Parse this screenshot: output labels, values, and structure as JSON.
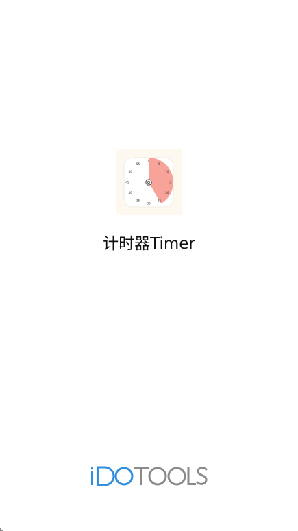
{
  "app": {
    "name": "计时器Timer",
    "icon": {
      "dial_numbers": [
        "0",
        "5",
        "10",
        "15",
        "20",
        "25",
        "30",
        "35",
        "40",
        "45",
        "50",
        "55"
      ],
      "remaining_minutes": 25,
      "colors": {
        "background": "#fdf9f1",
        "dial": "#ffffff",
        "sector": "#f7a39a",
        "ticks": "#333333"
      }
    }
  },
  "brand": {
    "logo_text": "iDOTOOLS",
    "colors": {
      "blue": "#2f8fe0",
      "gray": "#8a8a8a"
    }
  }
}
